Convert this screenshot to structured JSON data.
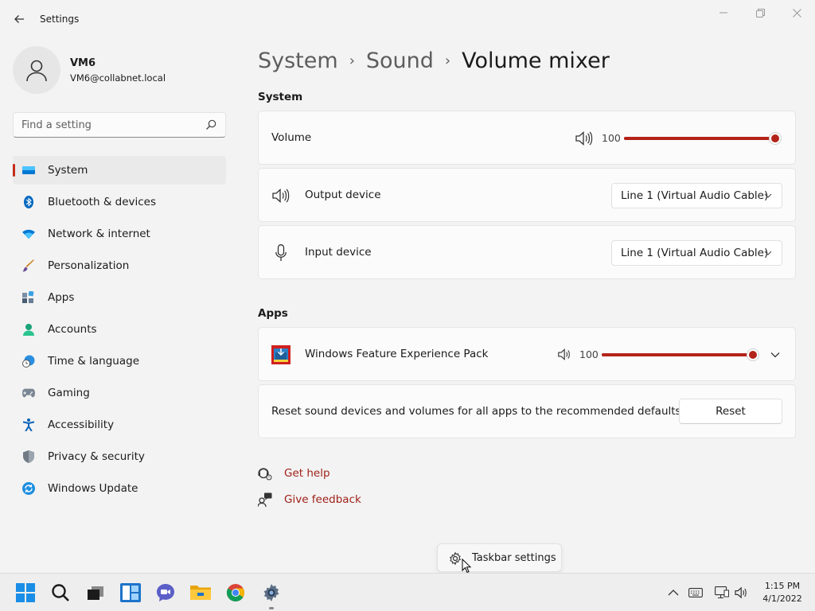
{
  "app": {
    "title": "Settings"
  },
  "user": {
    "name": "VM6",
    "email": "VM6@collabnet.local"
  },
  "search": {
    "placeholder": "Find a setting"
  },
  "nav": {
    "items": [
      {
        "label": "System",
        "icon": "monitor-icon",
        "active": true
      },
      {
        "label": "Bluetooth & devices",
        "icon": "bluetooth-icon"
      },
      {
        "label": "Network & internet",
        "icon": "wifi-icon"
      },
      {
        "label": "Personalization",
        "icon": "brush-icon"
      },
      {
        "label": "Apps",
        "icon": "apps-icon"
      },
      {
        "label": "Accounts",
        "icon": "person-icon"
      },
      {
        "label": "Time & language",
        "icon": "clock-globe-icon"
      },
      {
        "label": "Gaming",
        "icon": "gamepad-icon"
      },
      {
        "label": "Accessibility",
        "icon": "accessibility-icon"
      },
      {
        "label": "Privacy & security",
        "icon": "shield-icon"
      },
      {
        "label": "Windows Update",
        "icon": "update-icon"
      }
    ]
  },
  "breadcrumb": {
    "level1": "System",
    "level2": "Sound",
    "current": "Volume mixer",
    "separator": "›"
  },
  "system_section": {
    "title": "System",
    "volume": {
      "label": "Volume",
      "value": "100",
      "level": 1.0
    },
    "output": {
      "label": "Output device",
      "selected": "Line 1 (Virtual Audio Cable)"
    },
    "input": {
      "label": "Input device",
      "selected": "Line 1 (Virtual Audio Cable)"
    }
  },
  "apps_section": {
    "title": "Apps",
    "app": {
      "label": "Windows Feature Experience Pack",
      "value": "100",
      "level": 1.0
    },
    "reset": {
      "label": "Reset sound devices and volumes for all apps to the recommended defaults",
      "button": "Reset"
    }
  },
  "help": {
    "get_help": "Get help",
    "give_feedback": "Give feedback"
  },
  "tooltip": {
    "label": "Taskbar settings"
  },
  "taskbar": {
    "apps": [
      "start-icon",
      "search-icon",
      "task-view-icon",
      "widgets-icon",
      "chat-icon",
      "file-explorer-icon",
      "chrome-icon",
      "settings-icon"
    ],
    "clock": {
      "time": "1:15 PM",
      "date": "4/1/2022"
    }
  },
  "colors": {
    "accent": "#c42b1c",
    "link": "#9e1e16",
    "slider_fill": "#b4231a"
  }
}
